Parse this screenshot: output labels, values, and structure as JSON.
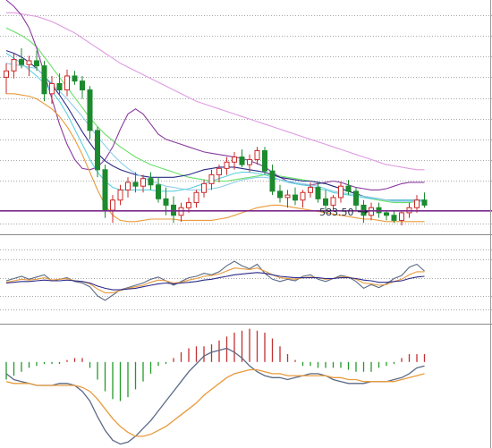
{
  "chart_data": [
    {
      "type": "candlestick",
      "panel": "price",
      "colors": {
        "up": "#cc2b2b",
        "down": "#1c8a2e",
        "upper_band": "#69e069",
        "lower_band": "#8a3a9e",
        "ma_orange": "#e89a3c",
        "ma_cyan": "#5ed0e0",
        "ma_navy": "#2b2b88",
        "ma_pink": "#e09ae0",
        "support_line": "#7b2a8c"
      },
      "candles": [
        [
          689,
          700,
          676,
          694
        ],
        [
          694,
          708,
          688,
          703
        ],
        [
          703,
          712,
          696,
          699
        ],
        [
          699,
          706,
          690,
          702
        ],
        [
          702,
          710,
          694,
          698
        ],
        [
          698,
          702,
          670,
          676
        ],
        [
          676,
          690,
          668,
          684
        ],
        [
          684,
          692,
          675,
          679
        ],
        [
          679,
          695,
          674,
          690
        ],
        [
          690,
          694,
          683,
          686
        ],
        [
          686,
          690,
          672,
          679
        ],
        [
          679,
          682,
          640,
          647
        ],
        [
          647,
          650,
          610,
          616
        ],
        [
          616,
          620,
          578,
          584
        ],
        [
          584,
          596,
          574,
          592
        ],
        [
          592,
          604,
          588,
          600
        ],
        [
          600,
          610,
          594,
          606
        ],
        [
          606,
          614,
          598,
          603
        ],
        [
          603,
          612,
          598,
          609
        ],
        [
          609,
          614,
          600,
          604
        ],
        [
          604,
          610,
          590,
          593
        ],
        [
          593,
          602,
          580,
          588
        ],
        [
          588,
          595,
          574,
          580
        ],
        [
          580,
          590,
          575,
          586
        ],
        [
          586,
          594,
          582,
          590
        ],
        [
          590,
          600,
          586,
          598
        ],
        [
          598,
          608,
          594,
          605
        ],
        [
          605,
          616,
          600,
          612
        ],
        [
          612,
          620,
          606,
          617
        ],
        [
          617,
          626,
          612,
          622
        ],
        [
          622,
          630,
          616,
          626
        ],
        [
          626,
          632,
          618,
          620
        ],
        [
          620,
          628,
          614,
          624
        ],
        [
          624,
          634,
          620,
          631
        ],
        [
          631,
          634,
          612,
          615
        ],
        [
          615,
          620,
          596,
          599
        ],
        [
          599,
          604,
          590,
          594
        ],
        [
          594,
          600,
          586,
          596
        ],
        [
          596,
          602,
          588,
          592
        ],
        [
          592,
          600,
          586,
          598
        ],
        [
          598,
          606,
          594,
          602
        ],
        [
          602,
          606,
          590,
          593
        ],
        [
          593,
          600,
          582,
          588
        ],
        [
          588,
          596,
          584,
          594
        ],
        [
          594,
          606,
          590,
          603
        ],
        [
          603,
          608,
          596,
          599
        ],
        [
          599,
          602,
          584,
          588
        ],
        [
          588,
          592,
          574,
          580
        ],
        [
          580,
          590,
          576,
          586
        ],
        [
          586,
          590,
          578,
          582
        ],
        [
          582,
          584,
          576,
          580
        ],
        [
          580,
          584,
          574,
          576
        ],
        [
          576,
          584,
          572,
          582
        ],
        [
          582,
          590,
          578,
          586
        ],
        [
          586,
          596,
          582,
          592
        ],
        [
          592,
          598,
          586,
          588
        ]
      ],
      "series": [
        {
          "values": [
            728,
            725,
            722,
            718,
            713,
            705,
            697,
            689,
            681,
            673,
            665,
            657,
            650,
            644,
            639,
            634,
            630,
            626,
            623,
            620,
            618,
            616,
            614,
            612,
            610,
            609,
            608,
            607,
            607,
            607,
            608,
            609,
            610,
            611,
            612,
            612,
            611,
            610,
            609,
            608,
            607,
            606,
            605,
            603,
            601,
            599,
            597,
            595,
            593,
            592,
            591,
            590,
            590,
            590,
            591,
            592
          ]
        },
        {
          "values": [
            676,
            676,
            675,
            674,
            672,
            668,
            664,
            658,
            650,
            640,
            628,
            614,
            600,
            588,
            580,
            576,
            575,
            575,
            576,
            577,
            577,
            577,
            577,
            576,
            576,
            576,
            576,
            576,
            577,
            578,
            580,
            582,
            584,
            586,
            587,
            588,
            588,
            587,
            586,
            585,
            584,
            583,
            582,
            581,
            580,
            579,
            578,
            577,
            577,
            576,
            575,
            575,
            575,
            575,
            575,
            575
          ]
        },
        {
          "values": [
            708,
            704,
            700,
            695,
            690,
            684,
            678,
            670,
            660,
            648,
            636,
            624,
            614,
            607,
            602,
            600,
            600,
            600,
            600,
            600,
            599,
            599,
            599,
            600,
            601,
            603,
            605,
            607,
            609,
            611,
            613,
            614,
            614,
            613,
            612,
            610,
            608,
            606,
            605,
            604,
            603,
            601,
            600,
            598,
            597,
            596,
            595,
            594,
            593,
            593,
            592,
            592,
            592,
            592,
            592,
            592
          ]
        },
        {
          "values": [
            710,
            708,
            705,
            701,
            696,
            690,
            683,
            675,
            666,
            656,
            646,
            637,
            629,
            623,
            619,
            616,
            614,
            612,
            611,
            610,
            610,
            610,
            610,
            611,
            612,
            614,
            616,
            617,
            618,
            618,
            618,
            617,
            616,
            615,
            614,
            612,
            610,
            609,
            608,
            607,
            607,
            606,
            605,
            603,
            601,
            599,
            597,
            595,
            594,
            593,
            592,
            592,
            592,
            592,
            592,
            592
          ]
        },
        {
          "values": [
            700,
            699,
            698,
            697,
            696,
            690,
            684,
            678,
            672,
            665,
            658,
            650,
            642,
            635,
            628,
            622,
            617,
            613,
            610,
            607,
            605,
            603,
            602,
            601,
            600,
            600,
            600,
            601,
            602,
            604,
            606,
            608,
            609,
            610,
            610,
            609,
            608,
            607,
            606,
            605,
            604,
            603,
            601,
            599,
            598,
            597,
            596,
            595,
            594,
            593,
            592,
            591,
            591,
            591,
            591,
            591
          ]
        },
        {
          "values": [
            740,
            740,
            739,
            738,
            737,
            735,
            733,
            730,
            727,
            724,
            720,
            716,
            712,
            708,
            704,
            700,
            697,
            694,
            691,
            688,
            685,
            682,
            679,
            676,
            673,
            670,
            668,
            666,
            664,
            662,
            660,
            658,
            656,
            654,
            652,
            650,
            648,
            646,
            644,
            642,
            640,
            638,
            636,
            634,
            632,
            630,
            628,
            626,
            624,
            622,
            620,
            619,
            618,
            617,
            616,
            616
          ]
        },
        {
          "values": [
            750,
            745,
            738,
            728,
            712,
            692,
            672,
            652,
            636,
            624,
            617,
            616,
            618,
            624,
            634,
            648,
            660,
            664,
            660,
            652,
            644,
            640,
            638,
            636,
            634,
            632,
            630,
            629,
            628,
            627,
            626,
            625,
            623,
            621,
            618,
            614,
            610,
            607,
            605,
            604,
            604,
            605,
            606,
            607,
            606,
            604,
            602,
            601,
            600,
            600,
            601,
            603,
            605,
            606,
            606,
            606
          ]
        }
      ],
      "annotations": [
        {
          "text": "583.50",
          "value": 583.5
        }
      ],
      "support_level": 583.5,
      "grid": true,
      "ylim": [
        565,
        750
      ]
    },
    {
      "type": "line",
      "panel": "oscillator",
      "series": [
        {
          "values": [
            50,
            53,
            56,
            52,
            55,
            58,
            50,
            52,
            54,
            49,
            47,
            42,
            30,
            24,
            31,
            38,
            41,
            44,
            47,
            52,
            55,
            50,
            44,
            49,
            54,
            56,
            60,
            58,
            62,
            70,
            76,
            70,
            66,
            72,
            60,
            52,
            49,
            52,
            50,
            56,
            58,
            52,
            49,
            53,
            57,
            55,
            49,
            40,
            45,
            41,
            46,
            53,
            57,
            68,
            72,
            63
          ]
        },
        {
          "values": [
            48,
            50,
            52,
            51,
            52,
            54,
            51,
            52,
            53,
            50,
            49,
            46,
            39,
            34,
            34,
            37,
            40,
            42,
            44,
            48,
            51,
            50,
            47,
            48,
            51,
            53,
            56,
            57,
            59,
            63,
            67,
            66,
            65,
            67,
            63,
            58,
            54,
            53,
            52,
            54,
            55,
            54,
            52,
            53,
            55,
            55,
            52,
            47,
            46,
            44,
            45,
            49,
            52,
            58,
            62,
            62
          ]
        },
        {
          "values": [
            47,
            48,
            49,
            49,
            50,
            51,
            50,
            50,
            51,
            50,
            49,
            47,
            43,
            40,
            38,
            38,
            39,
            40,
            42,
            44,
            46,
            47,
            46,
            47,
            48,
            49,
            51,
            52,
            54,
            56,
            58,
            59,
            60,
            61,
            60,
            58,
            56,
            55,
            54,
            54,
            54,
            54,
            53,
            53,
            54,
            54,
            53,
            51,
            50,
            48,
            48,
            49,
            50,
            53,
            55,
            56
          ]
        }
      ],
      "grid": true,
      "ylim": [
        0,
        100
      ]
    },
    {
      "type": "bar",
      "panel": "macd",
      "histogram": [
        -9,
        -7,
        -5,
        -3,
        -2,
        -1,
        -1,
        -1,
        1,
        2,
        2,
        -3,
        -9,
        -15,
        -19,
        -20,
        -18,
        -14,
        -10,
        -6,
        -2,
        -1,
        2,
        5,
        7,
        8,
        8,
        9,
        11,
        13,
        15,
        16,
        17,
        16,
        15,
        12,
        8,
        4,
        1,
        -2,
        -2,
        -3,
        -3,
        -3,
        -3,
        -4,
        -5,
        -5,
        -5,
        -3,
        -2,
        -1,
        2,
        4,
        4,
        4
      ],
      "series": [
        {
          "values": [
            -6,
            -9,
            -10,
            -11,
            -12,
            -12,
            -12,
            -11,
            -11,
            -12,
            -15,
            -20,
            -28,
            -35,
            -40,
            -42,
            -41,
            -38,
            -34,
            -30,
            -25,
            -20,
            -15,
            -10,
            -5,
            -1,
            3,
            5,
            6,
            7,
            5,
            2,
            -2,
            -5,
            -7,
            -8,
            -8,
            -9,
            -8,
            -7,
            -6,
            -6,
            -7,
            -9,
            -10,
            -11,
            -11,
            -11,
            -10,
            -10,
            -10,
            -9,
            -8,
            -6,
            -3,
            -2
          ]
        },
        {
          "values": [
            -10,
            -11,
            -11,
            -11,
            -12,
            -12,
            -12,
            -12,
            -12,
            -12,
            -13,
            -15,
            -19,
            -24,
            -29,
            -33,
            -36,
            -38,
            -38,
            -37,
            -35,
            -33,
            -30,
            -27,
            -24,
            -21,
            -17,
            -14,
            -11,
            -8,
            -6,
            -5,
            -4,
            -4,
            -5,
            -6,
            -6,
            -7,
            -7,
            -7,
            -7,
            -7,
            -7,
            -8,
            -8,
            -9,
            -9,
            -10,
            -10,
            -10,
            -10,
            -10,
            -9,
            -8,
            -7,
            -6
          ]
        }
      ],
      "grid": false,
      "ylim": [
        -44,
        15
      ]
    }
  ]
}
